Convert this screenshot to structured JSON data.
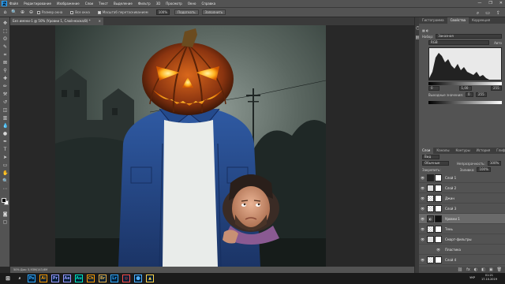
{
  "menubar": {
    "logo": "Ps",
    "items": [
      "Файл",
      "Редактирование",
      "Изображение",
      "Слои",
      "Текст",
      "Выделение",
      "Фильтр",
      "3D",
      "Просмотр",
      "Окно",
      "Справка"
    ],
    "controls": [
      "—",
      "❐",
      "✕"
    ]
  },
  "options": {
    "resize_label": "Размер окна",
    "fit_all_label": "Все окна",
    "scrubby_label": "Масштаб перетаскиванием",
    "zoom_value": "100%",
    "fit_button": "Подогнать",
    "fill_button": "Заполнить"
  },
  "document": {
    "tab_title": "Без имени-1 @ 50% (Уровни 1, Слой-маска/8) *",
    "close": "×",
    "status": "50%    Док: 5,93M/143,6M"
  },
  "panel": {
    "tabs": [
      "Гистограмма",
      "Свойства",
      "Коррекция"
    ],
    "active_tab": "Свойства",
    "preset_label": "Набор:",
    "preset_value": "Заказная",
    "channel_value": "RGB",
    "auto_label": "Авто",
    "input_low": "0",
    "input_mid": "1,00",
    "input_high": "255",
    "output_label": "Выходные значения:",
    "output_low": "0",
    "output_high": "255"
  },
  "layers_panel": {
    "tabs": [
      "Слои",
      "Каналы",
      "Контуры",
      "История",
      "Глифы"
    ],
    "kind_label": "Вид",
    "blend_mode": "Обычные",
    "opacity_label": "Непрозрачность:",
    "opacity_value": "100%",
    "lock_label": "Закрепить:",
    "fill_label": "Заливка:",
    "fill_value": "100%",
    "layers": [
      {
        "name": "Слой 1",
        "thumb": "dark",
        "selected": false
      },
      {
        "name": "Слой 2",
        "thumb": "light",
        "selected": false
      },
      {
        "name": "Джин",
        "thumb": "checker",
        "selected": false
      },
      {
        "name": "Слой 3",
        "thumb": "checker",
        "selected": false
      },
      {
        "name": "Уровни 1",
        "thumb": "adj",
        "selected": true
      },
      {
        "name": "Тень",
        "thumb": "checker",
        "selected": false
      },
      {
        "name": "Смарт-фильтры",
        "thumb": "light",
        "selected": false
      },
      {
        "name": "Пластика",
        "thumb": "none",
        "selected": false
      },
      {
        "name": "Слой 4",
        "thumb": "checker",
        "selected": false
      }
    ],
    "footer_icons": [
      "⛓",
      "fx",
      "◐",
      "◧",
      "▣",
      "🗑"
    ]
  },
  "taskbar": {
    "apps": [
      {
        "label": "Ps",
        "color": "#31a8ff"
      },
      {
        "label": "Ai",
        "color": "#ff9a00"
      },
      {
        "label": "Pr",
        "color": "#9999ff"
      },
      {
        "label": "Ae",
        "color": "#9999ff"
      },
      {
        "label": "Au",
        "color": "#00e4bb"
      },
      {
        "label": "Ch",
        "color": "#ff9a00"
      },
      {
        "label": "Br",
        "color": "#e8b04b"
      },
      {
        "label": "Lr",
        "color": "#31a8ff"
      },
      {
        "label": "◎",
        "color": "#ff4b4b"
      },
      {
        "label": "⬤",
        "color": "#4fb0ff"
      },
      {
        "label": "▲",
        "color": "#ffd24b"
      }
    ],
    "language": "УКР",
    "time": "01:21",
    "date": "17.10.2019"
  },
  "colors": {
    "chrome": "#535353",
    "dark": "#282828",
    "accent": "#31a8ff"
  }
}
